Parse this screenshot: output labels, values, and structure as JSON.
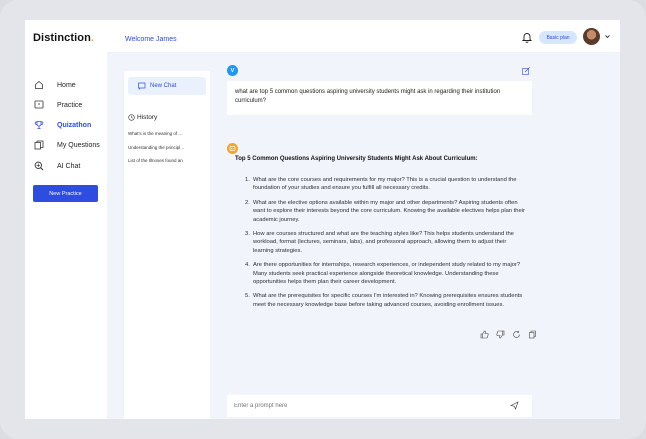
{
  "app": {
    "logo_text": "Distinction",
    "logo_dot": "."
  },
  "sidebar": {
    "items": [
      {
        "label": "Home",
        "icon": "home-icon"
      },
      {
        "label": "Practice",
        "icon": "chat-square-icon"
      },
      {
        "label": "Quizathon",
        "icon": "trophy-icon",
        "active": true
      },
      {
        "label": "My Questions",
        "icon": "copy-icon"
      },
      {
        "label": "AI Chat",
        "icon": "ai-search-icon"
      }
    ],
    "new_practice_label": "New Practice"
  },
  "header": {
    "welcome": "Welcome James",
    "plan_badge": "Basic plan"
  },
  "history": {
    "new_chat_label": "New Chat",
    "title": "History",
    "items": [
      "What's is  the meaning of ...",
      "Understanding the principl...",
      "List of the Illnoses found an"
    ]
  },
  "chat": {
    "user_initial": "V",
    "user_message": "what are top 5 common questions aspiring university students might ask in regarding their institution curriculum?",
    "answer_title": "Top 5 Common Questions Aspiring University Students Might Ask About Curriculum:",
    "answer_items": [
      "What are the core courses and requirements for my major? This is a crucial question to understand the foundation of your studies and ensure you fulfill all necessary credits.",
      "What are the elective options available within my major and other departments? Aspiring students often want to explore their interests beyond the core curriculum. Knowing the available electives helps plan their academic journey.",
      "How are courses structured and what are the teaching styles like? This helps students understand the workload, format (lectures, seminars, labs), and professoral approach, allowing them to adjust their learning strategies.",
      "Are there opportunities for internships, research experiences, or independent study related to my major? Many students seek practical experience alongside theoretical knowledge. Understanding these opportunities helps them plan their career development.",
      "What are the prerequisites for specific courses I'm interested in? Knowing prerequisites ensures students meet the necessary knowledge base before taking advanced courses, avoiding enrollment issues."
    ],
    "answer_numbers": [
      "1.",
      "2.",
      "3.",
      "4.",
      "5."
    ],
    "prompt_placeholder": "Enter a prompt here"
  },
  "colors": {
    "accent": "#2e4de0",
    "logo_dot": "#f5a623",
    "main_bg": "#f2f4fb",
    "badge_bg": "#d6e7fb"
  }
}
